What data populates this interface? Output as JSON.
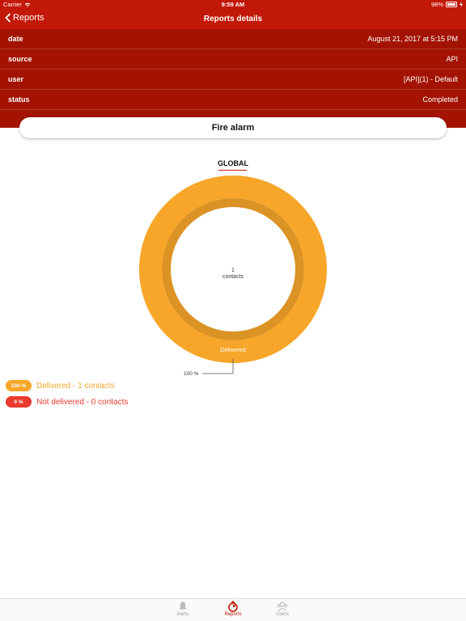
{
  "status_bar": {
    "carrier": "Carrier",
    "time": "9:59 AM",
    "battery": "98%"
  },
  "nav": {
    "back_label": "Reports",
    "title": "Reports details"
  },
  "details": [
    {
      "key": "date",
      "value": "August 21, 2017 at 5:15 PM"
    },
    {
      "key": "source",
      "value": "API"
    },
    {
      "key": "user",
      "value": "[API](1) - Default"
    },
    {
      "key": "status",
      "value": "Completed"
    }
  ],
  "report_title": "Fire alarm",
  "tab": {
    "label": "GLOBAL"
  },
  "chart_data": {
    "type": "pie",
    "categories": [
      "Delivered",
      "Not delivered"
    ],
    "values": [
      1,
      0
    ],
    "percent": [
      100,
      0
    ],
    "center_value": "1",
    "center_unit": "contacts",
    "slice_label": "Delivered",
    "callout_label": "100 %",
    "colors": {
      "delivered": "#f7a629",
      "delivered_inner": "#dc9325",
      "not_delivered": "#e83a2e"
    }
  },
  "legend": [
    {
      "badge": "100 %",
      "text": "Delivered - 1 contacts",
      "color": "#f7a629"
    },
    {
      "badge": "0 %",
      "text": "Not delivered - 0 contacts",
      "color": "#e83a2e"
    }
  ],
  "tabbar": {
    "items": [
      {
        "label": "Alerts",
        "icon": "bell-icon",
        "active": false
      },
      {
        "label": "Reports",
        "icon": "reports-icon",
        "active": true
      },
      {
        "label": "Users",
        "icon": "users-icon",
        "active": false
      }
    ]
  },
  "colors": {
    "brand": "#c21807",
    "details_bg": "#a31300"
  }
}
